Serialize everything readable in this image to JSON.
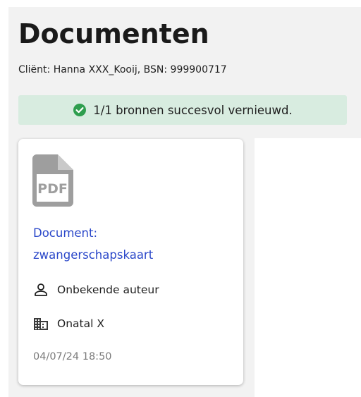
{
  "page": {
    "title": "Documenten",
    "client_info": "Cliënt: Hanna XXX_Kooij, BSN: 999900717"
  },
  "alert": {
    "message": "1/1 bronnen succesvol vernieuwd.",
    "icon": "check-circle-icon",
    "background": "#d8ece0",
    "icon_color": "#2e9e4e"
  },
  "documents": [
    {
      "type_icon": "pdf-file-icon",
      "title_line1": "Document:",
      "title_line2": "zwangerschapskaart",
      "author": "Onbekende auteur",
      "author_icon": "person-icon",
      "organization": "Onatal X",
      "organization_icon": "building-icon",
      "date": "04/07/24 18:50"
    }
  ],
  "colors": {
    "link": "#2a47c9",
    "panel_background": "#f2f2f2",
    "date_text": "#7a7a7a"
  }
}
